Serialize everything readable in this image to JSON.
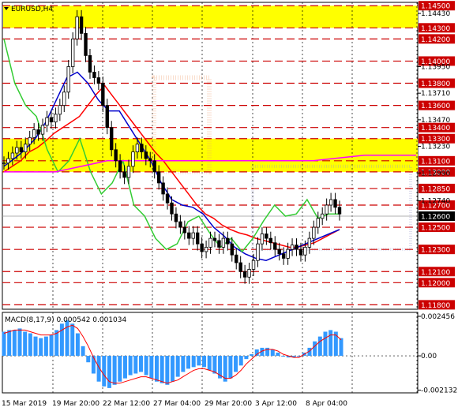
{
  "chart_data": [
    {
      "type": "candlestick",
      "title": "EURUSD,H4",
      "x_labels": [
        "15 Mar 2019",
        "19 Mar 20:00",
        "22 Mar 12:00",
        "27 Mar 04:00",
        "29 Mar 20:00",
        "3 Apr 12:00",
        "8 Apr 04:00"
      ],
      "ylim": [
        1.1176,
        1.1453
      ],
      "y_ticks": [
        1.1443,
        1.1395,
        1.1371,
        1.1347,
        1.1323,
        1.1299,
        1.1274
      ],
      "resistance_zones": [
        [
          1.143,
          1.145
        ],
        [
          1.13,
          1.133
        ]
      ],
      "levels": [
        {
          "label": "1.14500",
          "value": 1.145
        },
        {
          "label": "1.14300",
          "value": 1.143
        },
        {
          "label": "1.14200",
          "value": 1.142
        },
        {
          "label": "1.14000",
          "value": 1.14
        },
        {
          "label": "1.13800",
          "value": 1.138
        },
        {
          "label": "1.13600",
          "value": 1.136
        },
        {
          "label": "1.13400",
          "value": 1.134
        },
        {
          "label": "1.13300",
          "value": 1.133
        },
        {
          "label": "1.13100",
          "value": 1.131
        },
        {
          "label": "1.13000",
          "value": 1.13
        },
        {
          "label": "1.12850",
          "value": 1.1285
        },
        {
          "label": "1.12700",
          "value": 1.127
        },
        {
          "label": "1.12500",
          "value": 1.125
        },
        {
          "label": "1.12300",
          "value": 1.123
        },
        {
          "label": "1.12100",
          "value": 1.121
        },
        {
          "label": "1.12000",
          "value": 1.12
        },
        {
          "label": "1.11800",
          "value": 1.118
        }
      ],
      "current_price": {
        "label": "1.12600",
        "value": 1.126
      },
      "series": [
        {
          "color": "#000000",
          "values": [
            1.1308,
            1.1312,
            1.1317,
            1.1322,
            1.1318,
            1.1325,
            1.1331,
            1.1338,
            1.1334,
            1.1342,
            1.1349,
            1.1345,
            1.1352,
            1.136,
            1.1372,
            1.1395,
            1.142,
            1.144,
            1.1425,
            1.1405,
            1.139,
            1.1385,
            1.138,
            1.136,
            1.134,
            1.132,
            1.131,
            1.13,
            1.1295,
            1.1305,
            1.1318,
            1.1325,
            1.1318,
            1.1312,
            1.131,
            1.13,
            1.129,
            1.128,
            1.1272,
            1.1262,
            1.1255,
            1.125,
            1.1245,
            1.124,
            1.1245,
            1.1235,
            1.1228,
            1.1232,
            1.124,
            1.1238,
            1.1232,
            1.124,
            1.1235,
            1.1225,
            1.1218,
            1.121,
            1.1205,
            1.1212,
            1.122,
            1.1235,
            1.1244,
            1.124,
            1.1236,
            1.123,
            1.1226,
            1.1222,
            1.123,
            1.1234,
            1.123,
            1.1225,
            1.1232,
            1.124,
            1.125,
            1.1258,
            1.1262,
            1.127,
            1.1275,
            1.1268,
            1.1262
          ]
        },
        {
          "color": "#ff0000",
          "values": [
            1.13,
            1.1305,
            1.131,
            1.1318,
            1.1322,
            1.1328,
            1.1335,
            1.134,
            1.1345,
            1.135,
            1.136,
            1.137,
            1.1378,
            1.1368,
            1.1358,
            1.1348,
            1.1338,
            1.1328,
            1.1318,
            1.131,
            1.13,
            1.129,
            1.128,
            1.127,
            1.1262,
            1.1258,
            1.1252,
            1.1248,
            1.1245,
            1.1243,
            1.124,
            1.1238,
            1.1236,
            1.1234,
            1.1232,
            1.1232,
            1.1234,
            1.1236,
            1.124,
            1.1244,
            1.1248
          ]
        },
        {
          "color": "#0000cc",
          "values": [
            1.1305,
            1.1312,
            1.132,
            1.133,
            1.1345,
            1.1365,
            1.1385,
            1.139,
            1.138,
            1.1365,
            1.1355,
            1.1355,
            1.134,
            1.1325,
            1.131,
            1.129,
            1.1275,
            1.127,
            1.1268,
            1.1262,
            1.125,
            1.1242,
            1.1232,
            1.1226,
            1.1222,
            1.122,
            1.1224,
            1.1228,
            1.1232,
            1.1236,
            1.124,
            1.1244,
            1.1248
          ]
        },
        {
          "color": "#33cc33",
          "values": [
            1.142,
            1.138,
            1.136,
            1.135,
            1.132,
            1.13,
            1.131,
            1.133,
            1.13,
            1.128,
            1.129,
            1.131,
            1.127,
            1.126,
            1.124,
            1.123,
            1.1235,
            1.1255,
            1.126,
            1.1245,
            1.1232,
            1.124,
            1.1228,
            1.124,
            1.1256,
            1.127,
            1.126,
            1.1262,
            1.1275,
            1.1258,
            1.1262,
            1.1262
          ]
        },
        {
          "color": "#ff00ff",
          "values": [
            1.13,
            1.13,
            1.131,
            1.131,
            1.131,
            1.131,
            1.131,
            1.1315,
            1.1315
          ]
        }
      ]
    },
    {
      "type": "histogram",
      "title": "MACD(8,17,9) 0.000542 0.001034",
      "ylim": [
        -0.0023,
        0.0027
      ],
      "y_ticks": [
        0.002456,
        0.0,
        -0.002132
      ],
      "series": [
        {
          "name": "MACD",
          "color": "#3399ff",
          "values": [
            0.0015,
            0.0016,
            0.0016,
            0.0017,
            0.0015,
            0.0014,
            0.0012,
            0.0011,
            0.0012,
            0.0013,
            0.0016,
            0.002,
            0.0022,
            0.002,
            0.0014,
            0.0006,
            -0.0004,
            -0.0011,
            -0.0016,
            -0.0019,
            -0.002,
            -0.0018,
            -0.0016,
            -0.0014,
            -0.0012,
            -0.0011,
            -0.001,
            -0.0012,
            -0.0014,
            -0.0016,
            -0.0017,
            -0.0018,
            -0.0016,
            -0.0013,
            -0.001,
            -0.0008,
            -0.0007,
            -0.0006,
            -0.0007,
            -0.0009,
            -0.0011,
            -0.0014,
            -0.0016,
            -0.0014,
            -0.001,
            -0.0006,
            -0.0002,
            0.0001,
            0.0004,
            0.0005,
            0.0005,
            0.0004,
            0.0002,
            0.0,
            -0.0001,
            -0.0001,
            0.0,
            0.0002,
            0.0005,
            0.0009,
            0.0012,
            0.0015,
            0.0016,
            0.0015,
            0.0011
          ]
        },
        {
          "name": "Signal",
          "color": "#ff0000",
          "values": [
            0.0014,
            0.0015,
            0.0016,
            0.0016,
            0.0016,
            0.0015,
            0.0014,
            0.0013,
            0.0013,
            0.0013,
            0.0014,
            0.0016,
            0.0018,
            0.0019,
            0.0017,
            0.0012,
            0.0006,
            -0.0001,
            -0.0007,
            -0.0012,
            -0.0016,
            -0.0017,
            -0.0017,
            -0.0016,
            -0.0015,
            -0.0014,
            -0.0013,
            -0.0013,
            -0.0014,
            -0.0015,
            -0.0016,
            -0.0017,
            -0.0016,
            -0.0015,
            -0.0013,
            -0.0011,
            -0.0009,
            -0.0008,
            -0.0008,
            -0.0009,
            -0.001,
            -0.0012,
            -0.0014,
            -0.0014,
            -0.0012,
            -0.0009,
            -0.0005,
            -0.0002,
            0.0001,
            0.0003,
            0.0004,
            0.0004,
            0.0003,
            0.0001,
            0.0,
            -0.0001,
            -0.0001,
            0.0001,
            0.0003,
            0.0006,
            0.0009,
            0.0011,
            0.0013,
            0.0013,
            0.001
          ]
        }
      ]
    }
  ]
}
